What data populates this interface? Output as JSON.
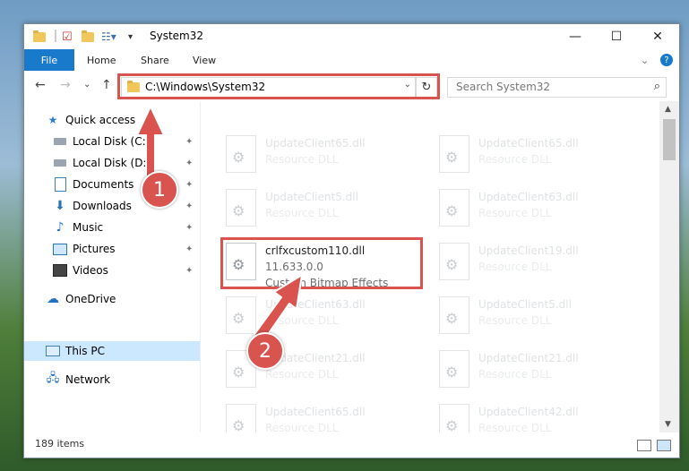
{
  "window": {
    "title": "System32",
    "controls": {
      "minimize": "—",
      "maximize": "☐",
      "close": "✕"
    }
  },
  "ribbon": {
    "tabs": [
      "File",
      "Home",
      "Share",
      "View"
    ],
    "collapse": "⌄",
    "help": "?"
  },
  "nav": {
    "back": "←",
    "forward": "→",
    "recent": "⌄",
    "up": "↑",
    "address": "C:\\Windows\\System32",
    "address_drop": "⌄",
    "refresh": "↻",
    "search_placeholder": "Search System32",
    "search_icon": "⌕"
  },
  "sidebar": {
    "items": [
      {
        "label": "Quick access",
        "icon": "star-icon",
        "pinned": false
      },
      {
        "label": "Local Disk (C:)",
        "icon": "drive-icon",
        "pinned": true
      },
      {
        "label": "Local Disk (D:)",
        "icon": "drive-icon",
        "pinned": true
      },
      {
        "label": "Documents",
        "icon": "document-icon",
        "pinned": true
      },
      {
        "label": "Downloads",
        "icon": "download-icon",
        "pinned": true
      },
      {
        "label": "Music",
        "icon": "music-icon",
        "pinned": true
      },
      {
        "label": "Pictures",
        "icon": "pictures-icon",
        "pinned": true
      },
      {
        "label": "Videos",
        "icon": "video-icon",
        "pinned": true
      },
      {
        "label": "OneDrive",
        "icon": "cloud-icon",
        "pinned": false
      },
      {
        "label": "This PC",
        "icon": "computer-icon",
        "pinned": false,
        "selected": true
      },
      {
        "label": "Network",
        "icon": "network-icon",
        "pinned": false
      }
    ],
    "pin_glyph": "📌"
  },
  "files": {
    "left": [
      {
        "name": "UpdateClient65.dll",
        "type": "Resource DLL"
      },
      {
        "name": "UpdateClient5.dll",
        "type": "Resource DLL"
      },
      {
        "name": "crlfxcustom110.dll",
        "version": "11.633.0.0",
        "type": "Custom Bitmap Effects",
        "highlight": true
      },
      {
        "name": "UpdateClient63.dll",
        "type": "Resource DLL"
      },
      {
        "name": "UpdateClient21.dll",
        "type": "Resource DLL"
      },
      {
        "name": "UpdateClient65.dll",
        "type": "Resource DLL"
      }
    ],
    "right": [
      {
        "name": "UpdateClient65.dll",
        "type": "Resource DLL"
      },
      {
        "name": "UpdateClient63.dll",
        "type": "Resource DLL"
      },
      {
        "name": "UpdateClient19.dll",
        "type": "Resource DLL"
      },
      {
        "name": "UpdateClient5.dll",
        "type": "Resource DLL"
      },
      {
        "name": "UpdateClient21.dll",
        "type": "Resource DLL"
      },
      {
        "name": "UpdateClient42.dll",
        "type": "Resource DLL"
      }
    ]
  },
  "status": {
    "items": "189 items"
  },
  "callouts": {
    "one": "1",
    "two": "2"
  },
  "colors": {
    "accent": "#1979ca",
    "callout": "#d9534f",
    "selected": "#cce8ff"
  }
}
